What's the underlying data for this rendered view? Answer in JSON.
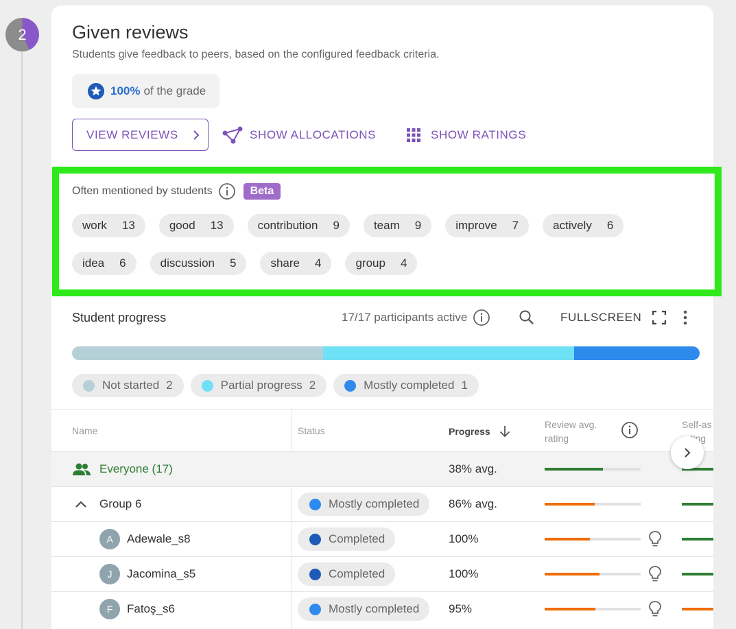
{
  "step": {
    "number": "2"
  },
  "header": {
    "title": "Given reviews",
    "subtitle": "Students give feedback to peers, based on the configured feedback criteria."
  },
  "grade": {
    "percent": "100%",
    "suffix": "of the grade"
  },
  "actions": {
    "view_reviews": "VIEW REVIEWS",
    "show_allocations": "SHOW ALLOCATIONS",
    "show_ratings": "SHOW RATINGS"
  },
  "mentions": {
    "label": "Often mentioned by students",
    "beta": "Beta",
    "keywords": [
      {
        "word": "work",
        "count": "13"
      },
      {
        "word": "good",
        "count": "13"
      },
      {
        "word": "contribution",
        "count": "9"
      },
      {
        "word": "team",
        "count": "9"
      },
      {
        "word": "improve",
        "count": "7"
      },
      {
        "word": "actively",
        "count": "6"
      },
      {
        "word": "idea",
        "count": "6"
      },
      {
        "word": "discussion",
        "count": "5"
      },
      {
        "word": "share",
        "count": "4"
      },
      {
        "word": "group",
        "count": "4"
      }
    ]
  },
  "progress": {
    "title": "Student progress",
    "participants": "17/17 participants active",
    "fullscreen": "FULLSCREEN",
    "segments": [
      {
        "label": "Not started",
        "count": "2",
        "color": "#b6d0d7",
        "fraction": 0.4
      },
      {
        "label": "Partial progress",
        "count": "2",
        "color": "#6fe1f7",
        "fraction": 0.4
      },
      {
        "label": "Mostly completed",
        "count": "1",
        "color": "#2f8aee",
        "fraction": 0.2
      }
    ]
  },
  "table": {
    "headers": {
      "name": "Name",
      "status": "Status",
      "progress": "Progress",
      "review_line1": "Review avg.",
      "review_line2": "rating",
      "self_line1": "Self-as",
      "self_line2": "rating"
    },
    "rows": [
      {
        "name": "Everyone (17)",
        "status": "",
        "progress": "38% avg.",
        "review_fill": 0.61,
        "review_color": "#2e7d32",
        "self_color": "#2e7d32",
        "type": "everyone"
      },
      {
        "name": "Group 6",
        "status": "Mostly completed",
        "status_color": "#2f8aee",
        "progress": "86% avg.",
        "review_fill": 0.52,
        "review_color": "#ef6c00",
        "self_color": "#2e7d32",
        "type": "group"
      },
      {
        "name": "Adewale_s8",
        "initial": "A",
        "status": "Completed",
        "status_color": "#1e5bb8",
        "progress": "100%",
        "review_fill": 0.47,
        "review_color": "#ef6c00",
        "self_color": "#2e7d32",
        "type": "student"
      },
      {
        "name": "Jacomina_s5",
        "initial": "J",
        "status": "Completed",
        "status_color": "#1e5bb8",
        "progress": "100%",
        "review_fill": 0.57,
        "review_color": "#ef6c00",
        "self_color": "#2e7d32",
        "type": "student"
      },
      {
        "name": "Fatoş_s6",
        "initial": "F",
        "status": "Mostly completed",
        "status_color": "#2f8aee",
        "progress": "95%",
        "review_fill": 0.53,
        "review_color": "#ef6c00",
        "self_color": "#ef6c00",
        "type": "student"
      }
    ]
  },
  "colors": {
    "accent": "#7b52b9",
    "highlight": "#2fe91b",
    "grade_blue": "#2a6fd1"
  },
  "icons": [
    "star-icon",
    "chevron-right-icon",
    "allocation-graph-icon",
    "grid-icon",
    "info-icon",
    "search-icon",
    "fullscreen-icon",
    "more-vert-icon",
    "arrow-down-icon",
    "group-icon",
    "chevron-up-icon",
    "lightbulb-icon"
  ]
}
